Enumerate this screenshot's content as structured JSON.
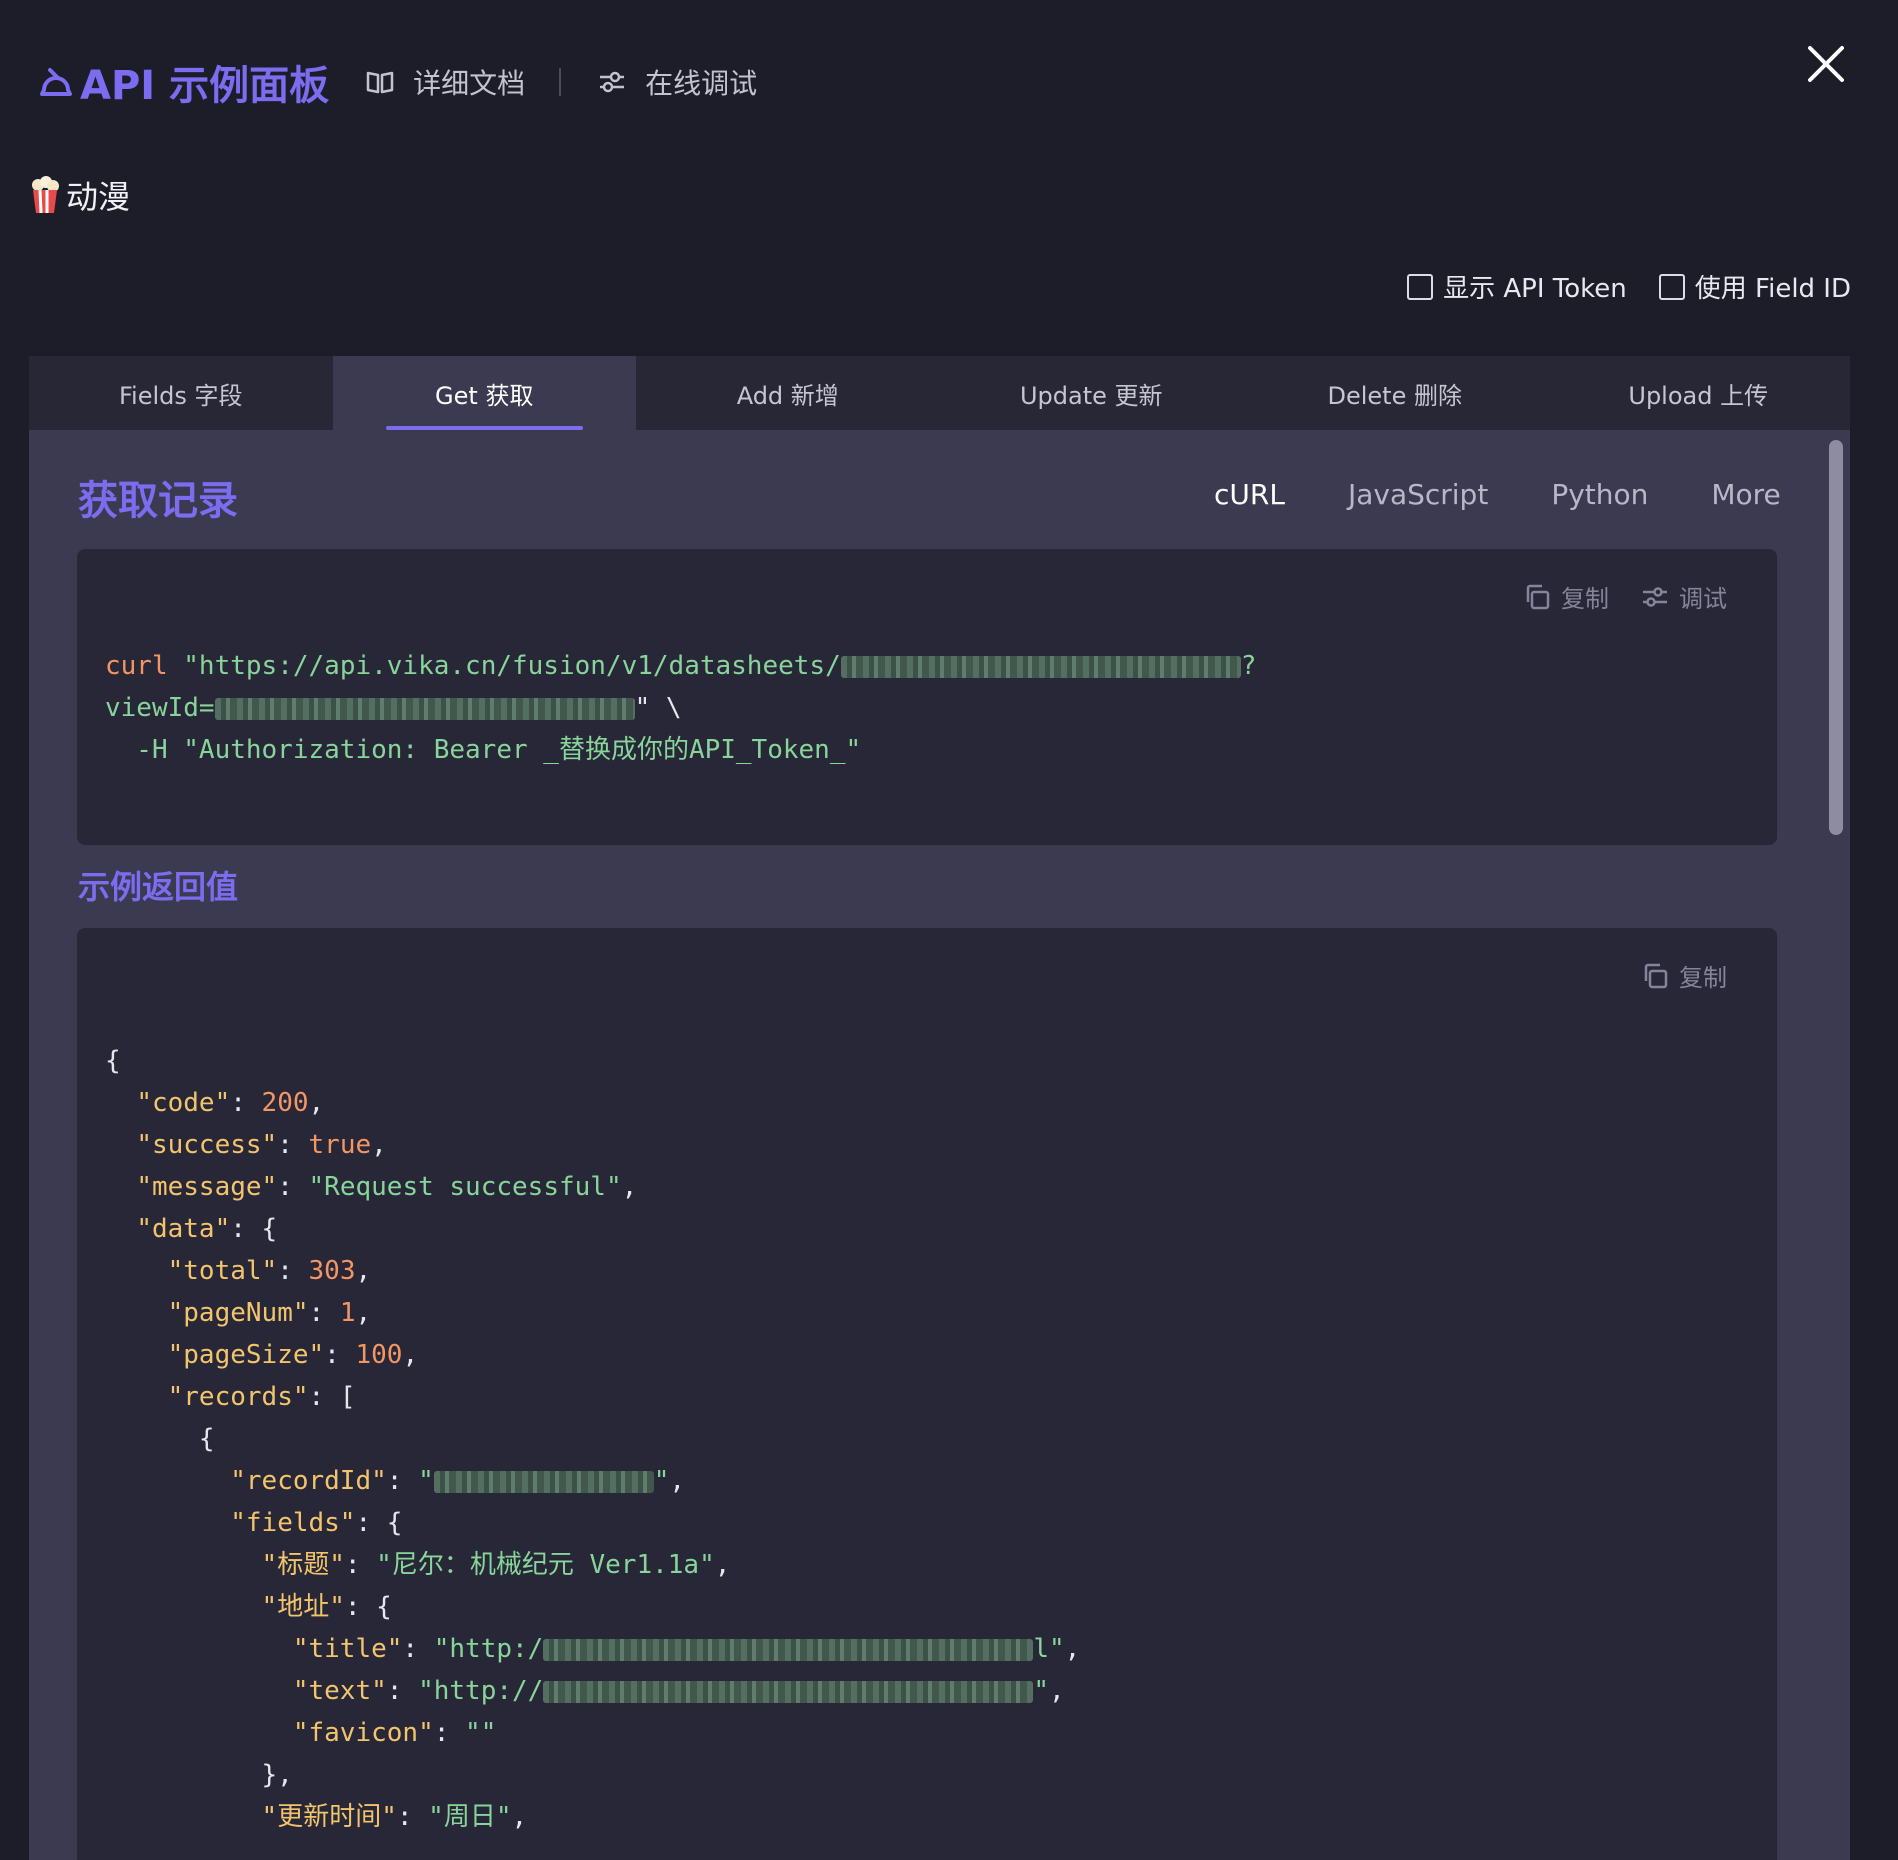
{
  "header": {
    "brand": "API 示例面板",
    "docs_label": "详细文档",
    "debug_label": "在线调试"
  },
  "section": {
    "title": "动漫"
  },
  "options": [
    {
      "label": "显示 API Token",
      "checked": false
    },
    {
      "label": "使用 Field ID",
      "checked": false
    }
  ],
  "tabs": [
    "Fields 字段",
    "Get 获取",
    "Add 新增",
    "Update 更新",
    "Delete 删除",
    "Upload 上传"
  ],
  "active_tab": "Get 获取",
  "panel": {
    "heading": "获取记录",
    "languages": [
      "cURL",
      "JavaScript",
      "Python",
      "More"
    ],
    "active_language": "cURL",
    "copy_label": "复制",
    "debug_label": "调试",
    "response_heading": "示例返回值"
  },
  "request": {
    "cmd": "curl",
    "url_prefix": "\"https://api.vika.cn/fusion/v1/datasheets/",
    "url_q": "?",
    "view_label": "viewId=",
    "view_end": "\" \\",
    "auth_line": "  -H \"Authorization: Bearer _替换成你的API_Token_\""
  },
  "response": {
    "code": 200,
    "success": "true",
    "message": "Request successful",
    "total": 303,
    "pageNum": 1,
    "pageSize": 100,
    "title_value": "尼尔：机械纪元 Ver1.1a",
    "url_start_1": "\"http:/",
    "url_end_1": "l\"",
    "url_start_2": "\"http://",
    "url_end_2": "\"",
    "favicon": "\"\"",
    "update_time": "周日"
  },
  "colors": {
    "accent": "#7b6cf0",
    "background": "#1d1d2a",
    "panel": "#3b3a50",
    "code_bg": "#272737"
  }
}
